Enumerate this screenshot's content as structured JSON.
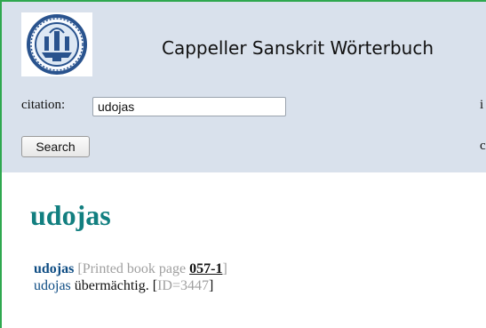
{
  "header": {
    "title": "Cappeller Sanskrit Wörterbuch",
    "citation_label": "citation:",
    "citation_value": "udojas",
    "search_label": "Search",
    "cut_text_1": "i",
    "cut_text_2": "c"
  },
  "entry": {
    "headword": "udojas",
    "lines": [
      {
        "term": "udojas",
        "meta_prefix": "[Printed book page ",
        "page": "057-1",
        "meta_suffix": "]"
      },
      {
        "term": "udojas",
        "definition": " übermächtig. ",
        "id_open": "[",
        "id_text": "ID=3447",
        "id_close": "]"
      }
    ]
  },
  "colors": {
    "header_bg": "#d9e1ec",
    "headword": "#127f80",
    "term": "#0d4c83",
    "meta": "#a0a0a0",
    "border": "#2fa84f"
  },
  "icons": {
    "logo": "university-seal-icon"
  }
}
